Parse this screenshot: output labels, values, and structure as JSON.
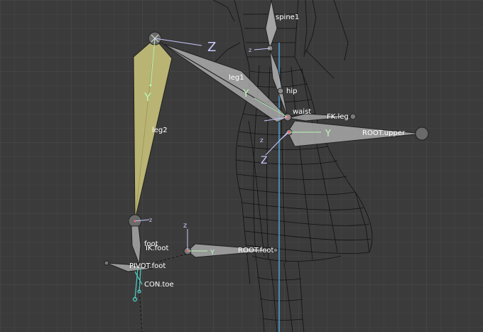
{
  "viewport": {
    "background_color": "#3b3b3b",
    "grid_color": "#474747",
    "mesh_color": "#101010"
  },
  "colors": {
    "bone_fill": "#a9a9a9",
    "bone_selected_fill": "#c8c27a",
    "bone_outline": "#202020",
    "axis_x": "#c9c9ff",
    "axis_y": "#b9f5b9",
    "object_axis": "#4aa3d6",
    "ik_chain": "#4fd0c8"
  },
  "bones": {
    "spine1": "spine1",
    "leg1": "leg1",
    "hip": "hip",
    "waist": "waist",
    "fk_leg": "FK.leg",
    "root_upper": "ROOT.upper",
    "leg2": "leg2",
    "foot": "foot",
    "ik_foot": "IK.foot",
    "pivot_foot": "PIVOT.foot",
    "con_toe": "CON.toe",
    "root_foot": "ROOT.foot"
  },
  "axes": {
    "z": "Z",
    "y": "Y",
    "z_small": "z"
  }
}
